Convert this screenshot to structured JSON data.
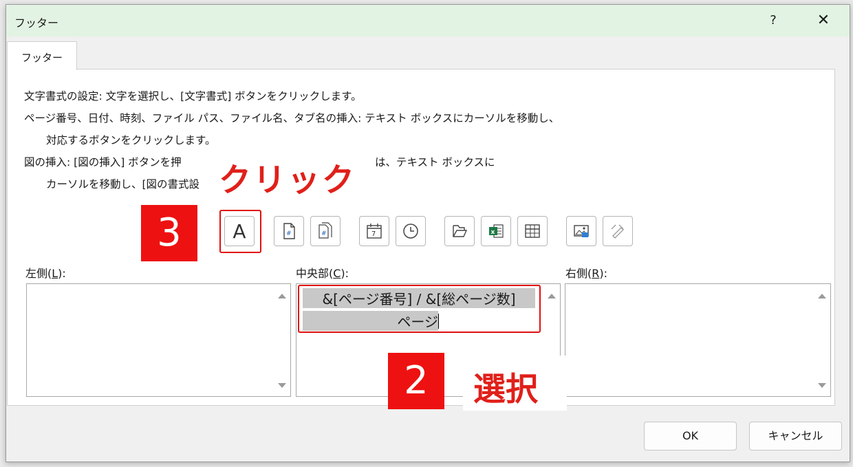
{
  "dialog": {
    "title": "フッター",
    "help": "?",
    "close": "✕"
  },
  "tab": {
    "label": "フッター"
  },
  "instructions": {
    "line1": "文字書式の設定: 文字を選択し、[文字書式] ボタンをクリックします。",
    "line2": "ページ番号、日付、時刻、ファイル パス、ファイル名、タブ名の挿入: テキスト ボックスにカーソルを移動し、",
    "line3": "対応するボタンをクリックします。",
    "line4a": "図の挿入: [図の挿入] ボタンを押",
    "line4b": "は、テキスト ボックスに",
    "line5": "カーソルを移動し、[図の書式設"
  },
  "annotations": {
    "click": "クリック",
    "step3": "3",
    "step2": "2",
    "select": "選択"
  },
  "toolbar": {
    "format_text_glyph": "A"
  },
  "sections": {
    "left_label": "左側(",
    "left_key": "L",
    "left_close": "):",
    "center_label": "中央部(",
    "center_key": "C",
    "center_close": "):",
    "right_label": "右側(",
    "right_key": "R",
    "right_close": "):"
  },
  "center_text": {
    "line1": "&[ページ番号] / &[総ページ数]",
    "line2": "ページ"
  },
  "buttons": {
    "ok": "OK",
    "cancel": "キャンセル"
  },
  "colors": {
    "accent_red": "#ee1111",
    "title_bar": "#e3f3e3"
  }
}
